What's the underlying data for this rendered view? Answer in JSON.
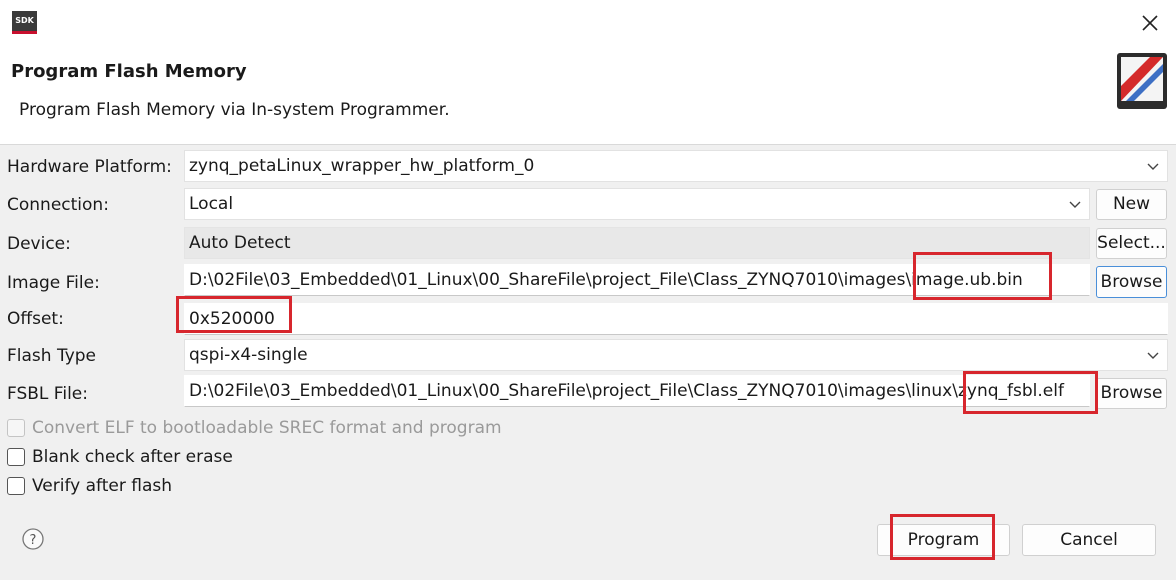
{
  "window": {
    "app_icon_text": "SDK",
    "title": "Program Flash Memory",
    "description": "Program Flash Memory via In-system Programmer.",
    "close_icon": "close-icon"
  },
  "form": {
    "hardware_platform": {
      "label": "Hardware Platform:",
      "value": "zynq_petaLinux_wrapper_hw_platform_0"
    },
    "connection": {
      "label": "Connection:",
      "value": "Local",
      "new_button": "New"
    },
    "device": {
      "label": "Device:",
      "value": "Auto Detect",
      "select_button": "Select..."
    },
    "image_file": {
      "label": "Image File:",
      "value": "D:\\02File\\03_Embedded\\01_Linux\\00_ShareFile\\project_File\\Class_ZYNQ7010\\images\\image.ub.bin",
      "browse_button": "Browse"
    },
    "offset": {
      "label": "Offset:",
      "value": "0x520000"
    },
    "flash_type": {
      "label": "Flash Type",
      "value": "qspi-x4-single"
    },
    "fsbl_file": {
      "label": "FSBL File:",
      "value": "D:\\02File\\03_Embedded\\01_Linux\\00_ShareFile\\project_File\\Class_ZYNQ7010\\images\\linux\\zynq_fsbl.elf",
      "browse_button": "Browse"
    }
  },
  "options": {
    "convert_elf": {
      "label": "Convert ELF to bootloadable SREC format and program",
      "checked": false,
      "enabled": false
    },
    "blank_check": {
      "label": "Blank check after erase",
      "checked": false
    },
    "verify": {
      "label": "Verify after flash",
      "checked": false
    }
  },
  "footer": {
    "help_icon": "help-icon",
    "program_button": "Program",
    "cancel_button": "Cancel"
  },
  "colors": {
    "highlight": "#d7262d",
    "focus_border": "#4a8fd9",
    "dialog_bg": "#f0f0f0"
  }
}
